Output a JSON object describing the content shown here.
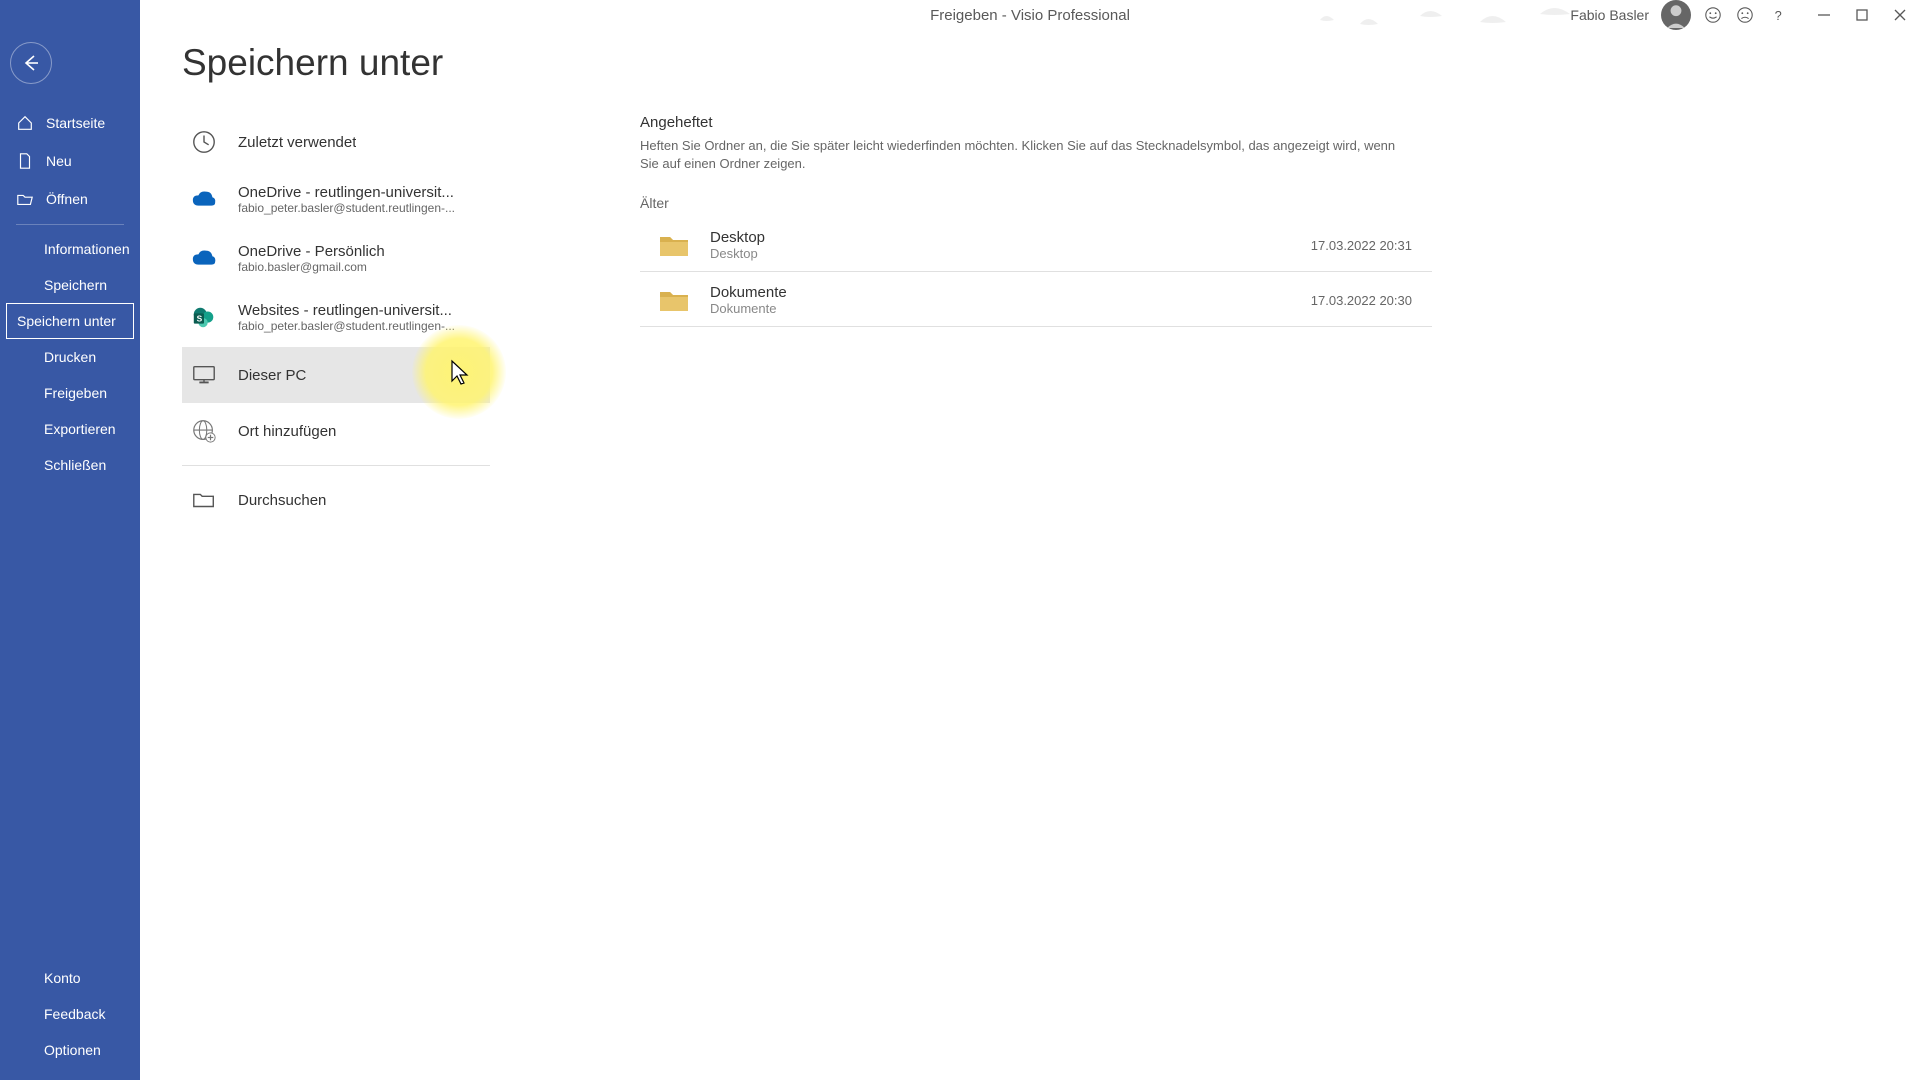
{
  "titlebar": {
    "title": "Freigeben  -  Visio Professional",
    "user": "Fabio Basler"
  },
  "sidebar": {
    "top": [
      {
        "id": "home",
        "label": "Startseite",
        "icon": "home"
      },
      {
        "id": "new",
        "label": "Neu",
        "icon": "doc"
      },
      {
        "id": "open",
        "label": "Öffnen",
        "icon": "open"
      }
    ],
    "middle": [
      {
        "id": "info",
        "label": "Informationen"
      },
      {
        "id": "save",
        "label": "Speichern"
      },
      {
        "id": "saveas",
        "label": "Speichern unter",
        "active": true
      },
      {
        "id": "print",
        "label": "Drucken"
      },
      {
        "id": "share",
        "label": "Freigeben"
      },
      {
        "id": "export",
        "label": "Exportieren"
      },
      {
        "id": "close",
        "label": "Schließen"
      }
    ],
    "bottom": [
      {
        "id": "account",
        "label": "Konto"
      },
      {
        "id": "feedback",
        "label": "Feedback"
      },
      {
        "id": "options",
        "label": "Optionen"
      }
    ]
  },
  "page": {
    "title": "Speichern unter"
  },
  "locations": [
    {
      "id": "recent",
      "title": "Zuletzt verwendet",
      "icon": "clock"
    },
    {
      "id": "odbiz",
      "title": "OneDrive - reutlingen-universit...",
      "sub": "fabio_peter.basler@student.reutlingen-...",
      "icon": "cloud-blue"
    },
    {
      "id": "odpers",
      "title": "OneDrive - Persönlich",
      "sub": "fabio.basler@gmail.com",
      "icon": "cloud-blue"
    },
    {
      "id": "sites",
      "title": "Websites - reutlingen-universit...",
      "sub": "fabio_peter.basler@student.reutlingen-...",
      "icon": "sharepoint"
    },
    {
      "id": "thispc",
      "title": "Dieser PC",
      "icon": "pc",
      "selected": true
    },
    {
      "id": "addplace",
      "title": "Ort hinzufügen",
      "icon": "globe-plus"
    },
    {
      "id": "browse",
      "title": "Durchsuchen",
      "icon": "folder-open"
    }
  ],
  "pinned": {
    "header": "Angeheftet",
    "desc": "Heften Sie Ordner an, die Sie später leicht wiederfinden möchten. Klicken Sie auf das Stecknadelsymbol, das angezeigt wird, wenn Sie auf einen Ordner zeigen."
  },
  "older": {
    "header": "Älter",
    "folders": [
      {
        "name": "Desktop",
        "path": "Desktop",
        "date": "17.03.2022 20:31"
      },
      {
        "name": "Dokumente",
        "path": "Dokumente",
        "date": "17.03.2022 20:30"
      }
    ]
  }
}
